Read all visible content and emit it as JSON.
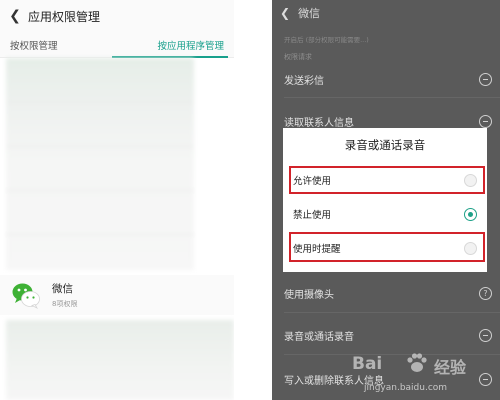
{
  "left": {
    "header": {
      "back_icon": "chevron-left-icon",
      "title": "应用权限管理"
    },
    "tabs": [
      {
        "label": "按权限管理",
        "active": false
      },
      {
        "label": "按应用程序管理",
        "active": true
      }
    ],
    "accent_color": "#18a08c",
    "app": {
      "name": "微信",
      "subtitle": "8项权限",
      "icon": "wechat-icon"
    }
  },
  "right": {
    "header": {
      "back_icon": "chevron-left-icon",
      "title": "微信"
    },
    "faint_text": "开启后 (部分权限可能需要...)",
    "section_label": "权限请求",
    "rows": [
      {
        "label": "发送彩信",
        "icon": "minus-circle-icon"
      },
      {
        "label": "读取联系人信息",
        "icon": "minus-circle-icon"
      },
      {
        "label": "使用摄像头",
        "icon": "question-circle-icon"
      },
      {
        "label": "录音或通话录音",
        "icon": "minus-circle-icon"
      },
      {
        "label": "写入或删除联系人信息",
        "icon": "minus-circle-icon"
      }
    ],
    "question_mark": "?",
    "dialog": {
      "title": "录音或通话录音",
      "options": [
        {
          "label": "允许使用",
          "selected": false,
          "highlighted": true
        },
        {
          "label": "禁止使用",
          "selected": true,
          "highlighted": false
        },
        {
          "label": "使用时提醒",
          "selected": false,
          "highlighted": true
        }
      ],
      "selected_color": "#1ea188",
      "highlight_color": "#d2232a"
    }
  },
  "watermark": {
    "brand": "Bai",
    "brand_tail": "经验",
    "url": "jingyan.baidu.com"
  }
}
